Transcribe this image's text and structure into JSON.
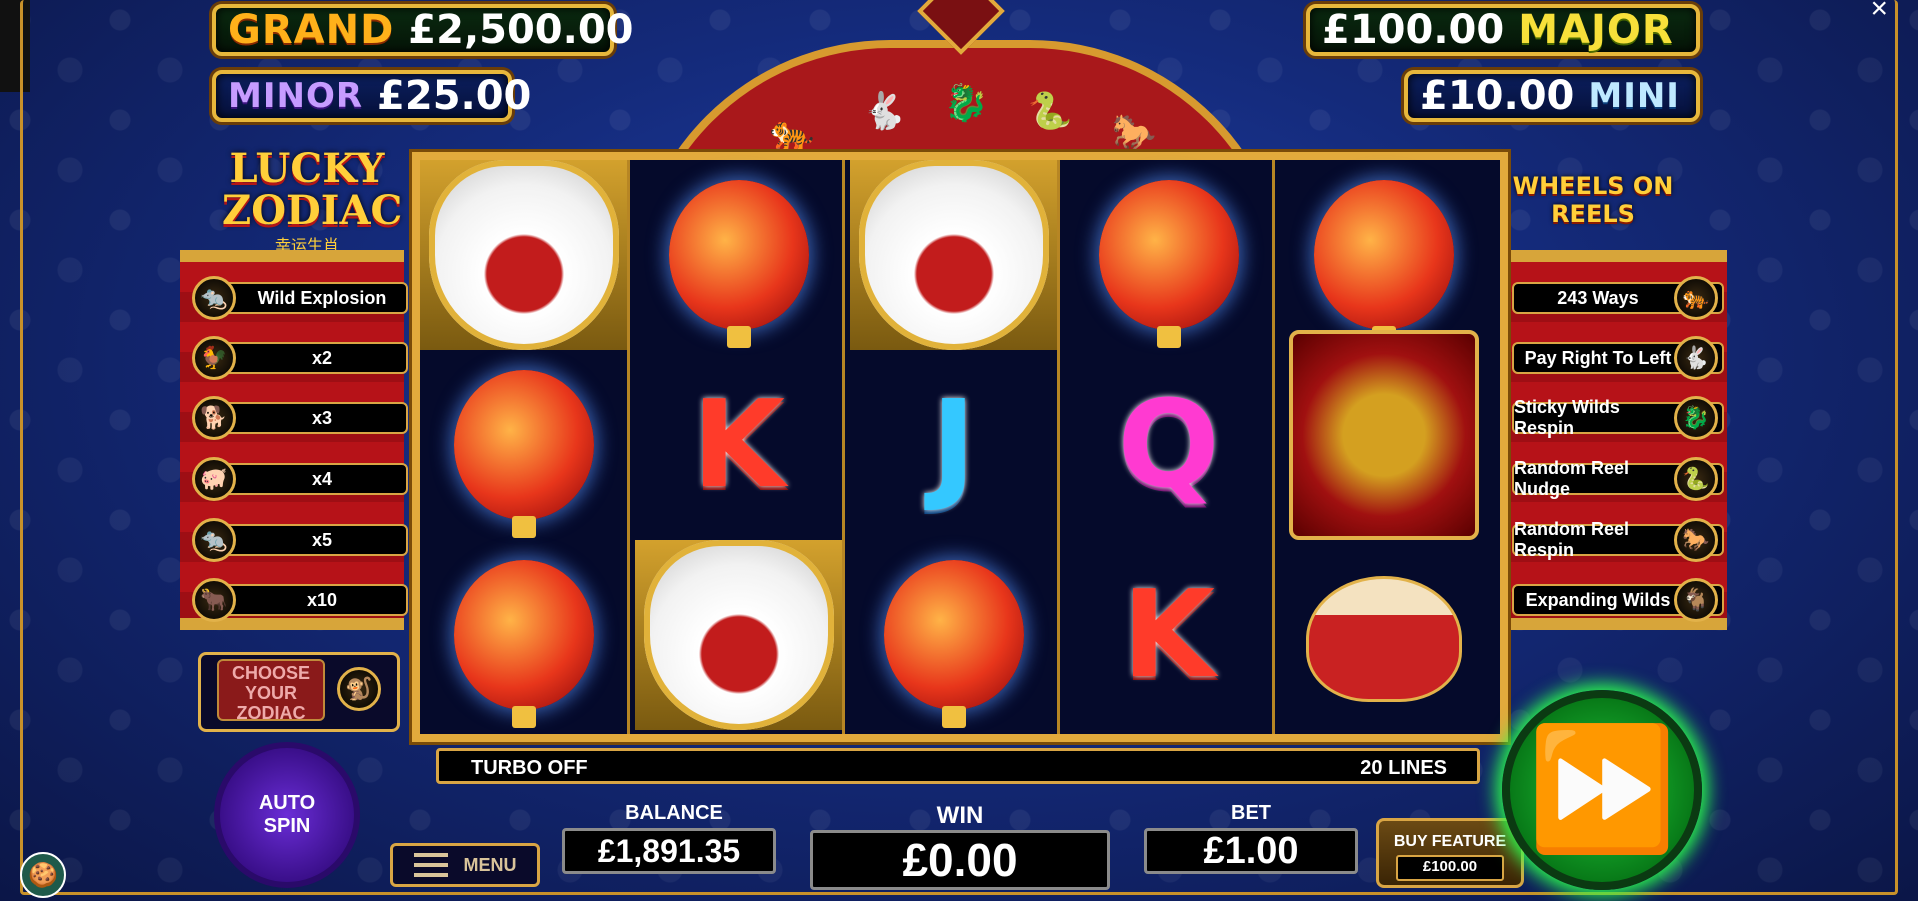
{
  "jackpots": {
    "grand": {
      "label": "GRAND",
      "value": "£2,500.00"
    },
    "minor": {
      "label": "MINOR",
      "value": "£25.00"
    },
    "major": {
      "label": "MAJOR",
      "value": "£100.00"
    },
    "mini": {
      "label": "MINI",
      "value": "£10.00"
    }
  },
  "logos": {
    "game_title_line1": "LUCKY",
    "game_title_line2": "ZODIAC",
    "game_subtitle": "幸运生肖",
    "wheels_on_reels": "WHEELS ON REELS"
  },
  "left_features": [
    {
      "label": "Wild Explosion",
      "icon": "rat-icon"
    },
    {
      "label": "x2",
      "icon": "rooster-icon"
    },
    {
      "label": "x3",
      "icon": "dog-icon"
    },
    {
      "label": "x4",
      "icon": "pig-icon"
    },
    {
      "label": "x5",
      "icon": "rat-icon"
    },
    {
      "label": "x10",
      "icon": "ox-icon"
    }
  ],
  "right_features": [
    {
      "label": "243 Ways",
      "icon": "tiger-icon"
    },
    {
      "label": "Pay Right To Left",
      "icon": "rabbit-icon"
    },
    {
      "label": "Sticky Wilds Respin",
      "icon": "dragon-icon"
    },
    {
      "label": "Random Reel Nudge",
      "icon": "snake-icon"
    },
    {
      "label": "Random Reel Respin",
      "icon": "horse-icon"
    },
    {
      "label": "Expanding Wilds",
      "icon": "goat-icon"
    }
  ],
  "choose_zodiac": {
    "label": "CHOOSE YOUR ZODIAC"
  },
  "reels": [
    [
      "lion-wild",
      "lantern",
      "lantern"
    ],
    [
      "lantern",
      "K",
      "lion-wild"
    ],
    [
      "lion-wild",
      "J",
      "lantern"
    ],
    [
      "lantern",
      "Q",
      "K"
    ],
    [
      "lantern",
      "monkey",
      "drum"
    ]
  ],
  "info_bar": {
    "turbo": "TURBO OFF",
    "lines": "20 LINES"
  },
  "autospin": {
    "line1": "AUTO",
    "line2": "SPIN"
  },
  "menu": {
    "label": "MENU"
  },
  "balance": {
    "label": "BALANCE",
    "value": "£1,891.35"
  },
  "win": {
    "label": "WIN",
    "value": "£0.00"
  },
  "bet": {
    "label": "BET",
    "value": "£1.00"
  },
  "buy_feature": {
    "label": "BUY FEATURE",
    "price": "£100.00"
  },
  "colors": {
    "gold": "#e2aa3c",
    "spin_green": "#21c83a",
    "reel_red": "#a9181b"
  }
}
